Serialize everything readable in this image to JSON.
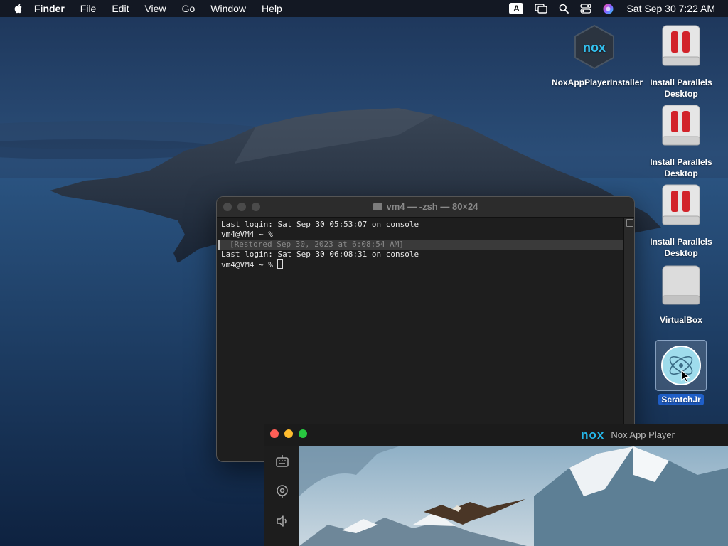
{
  "menubar": {
    "app_name": "Finder",
    "menus": [
      "File",
      "Edit",
      "View",
      "Go",
      "Window",
      "Help"
    ],
    "input_badge": "A",
    "clock": "Sat Sep 30  7:22 AM"
  },
  "desktop_icons": {
    "nox_installer": "NoxAppPlayerInstaller",
    "parallels_1": "Install Parallels Desktop",
    "parallels_2": "Install Parallels Desktop",
    "parallels_3": "Install Parallels Desktop",
    "virtualbox": "VirtualBox",
    "scratchjr": "ScratchJr"
  },
  "terminal": {
    "title": "vm4 — -zsh — 80×24",
    "lines": [
      "Last login: Sat Sep 30 05:53:07 on console",
      "vm4@VM4 ~ %",
      "[Restored Sep 30, 2023 at 6:08:54 AM]",
      "Last login: Sat Sep 30 06:08:31 on console",
      "vm4@VM4 ~ % "
    ]
  },
  "nox": {
    "logo": "nox",
    "title": "Nox App Player"
  },
  "colors": {
    "selection_blue": "#1f5fc9",
    "nox_brand": "#25b6e8",
    "close_red": "#ff5f57",
    "minimize_yellow": "#febc2e",
    "zoom_green": "#28c840"
  }
}
